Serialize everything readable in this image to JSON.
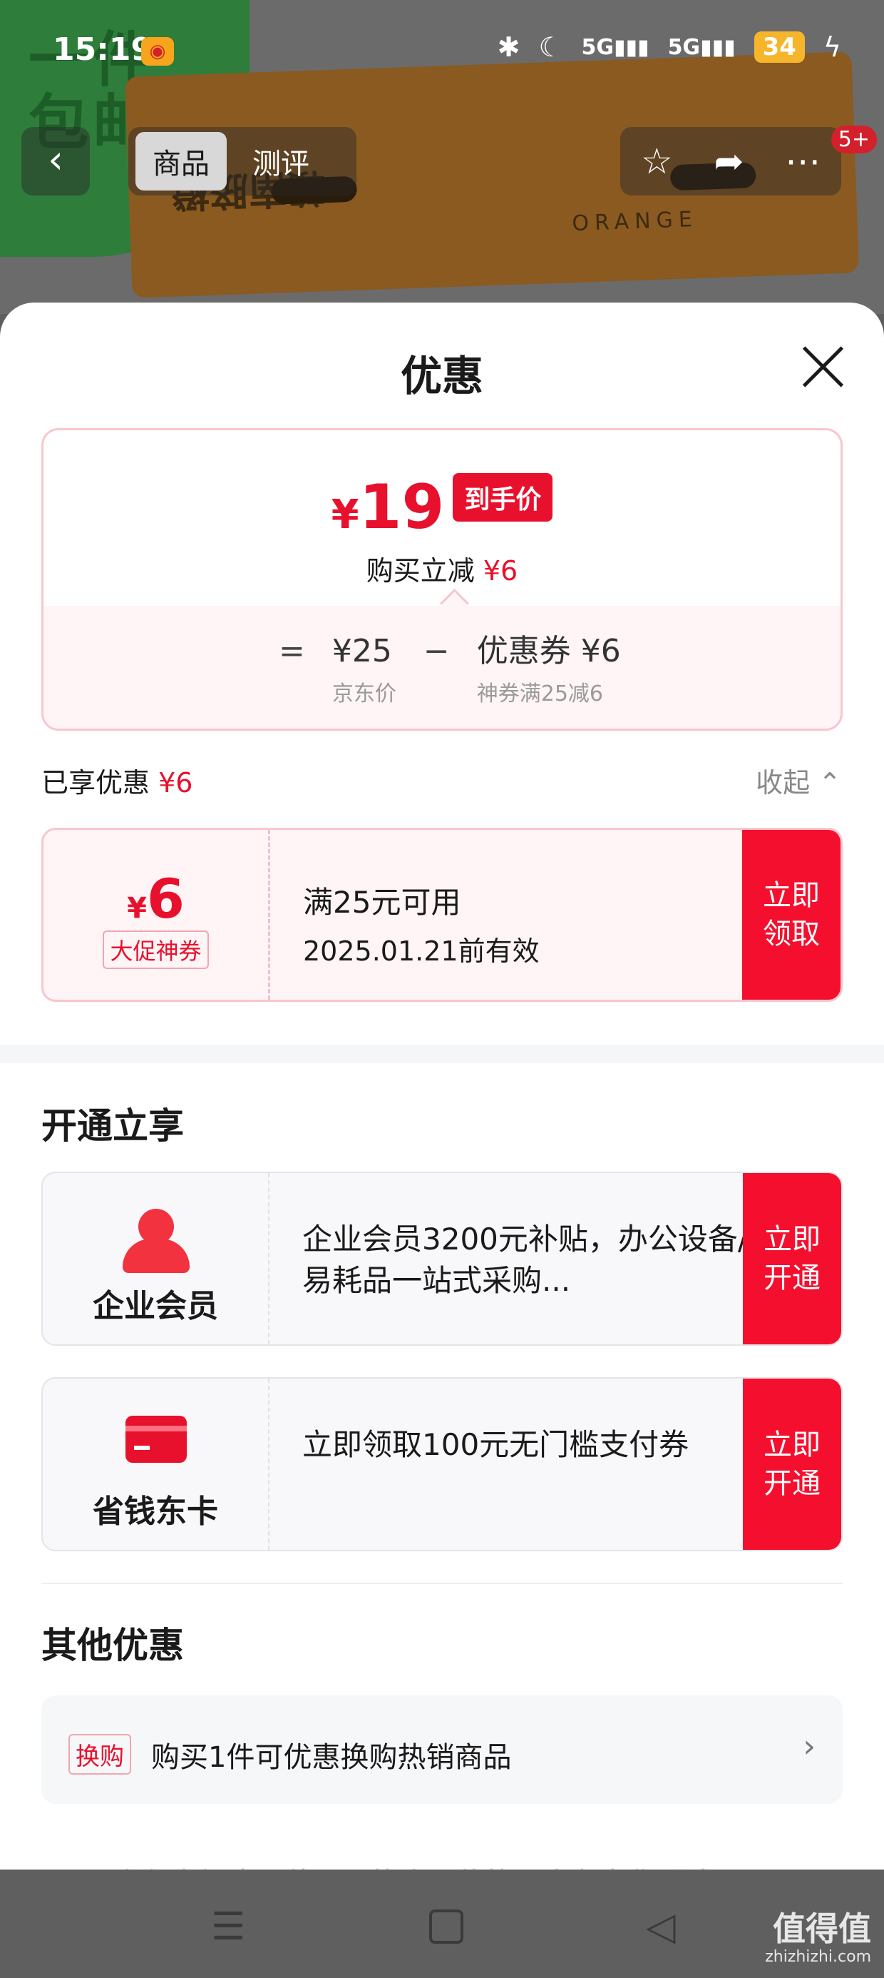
{
  "status_bar": {
    "time": "15:19",
    "signal_1": "5G",
    "signal_2": "5G",
    "battery": "34"
  },
  "hero": {
    "banner_text": "一件\n包邮",
    "box_label": "赣南脐橙",
    "box_sub": "ORANGE"
  },
  "nav": {
    "back_icon": "chevron-left-icon",
    "tabs": [
      {
        "label": "商品",
        "active": true
      },
      {
        "label": "测评",
        "active": false
      }
    ],
    "actions": [
      "star-icon",
      "share-icon",
      "more-icon"
    ],
    "badge": "5+"
  },
  "sheet": {
    "title": "优惠",
    "price": {
      "currency": "¥",
      "final": "19",
      "tag": "到手价",
      "cut_label": "购买立减",
      "cut_value": "¥6",
      "formula": {
        "equals": "=",
        "base_value": "¥25",
        "base_label": "京东价",
        "minus": "−",
        "coupon_value": "优惠券 ¥6",
        "coupon_label": "神券满25减6"
      }
    },
    "enjoyed": {
      "label": "已享优惠",
      "value": "¥6"
    },
    "collapse": "收起 ⌃",
    "coupon": {
      "currency": "¥",
      "amount": "6",
      "tag": "大促神券",
      "condition": "满25元可用",
      "expiry": "2025.01.21前有效",
      "cta": "立即\n领取"
    },
    "open_section": {
      "title": "开通立享",
      "items": [
        {
          "name": "企业会员",
          "desc": "企业会员3200元补贴，办公设备/易耗品一站式采购...",
          "cta": "立即\n开通"
        },
        {
          "name": "省钱东卡",
          "desc": "立即领取100元无门槛支付券",
          "cta": "立即\n开通"
        }
      ]
    },
    "other_section": {
      "title": "其他优惠",
      "row": {
        "tag": "换购",
        "text": "购买1件可优惠换购热销商品",
        "chevron": "›"
      }
    },
    "peek_text": "以上仅为初步预估，可能会因价格、库存变化影响"
  },
  "system_nav": {
    "menu": "☰",
    "back": "◁"
  },
  "watermark": {
    "main": "值得值",
    "sub": "zhizhizhi.com"
  },
  "colors": {
    "accent": "#e8112d",
    "cta": "#f50f2e",
    "coupon_bg": "#fff5f6"
  }
}
